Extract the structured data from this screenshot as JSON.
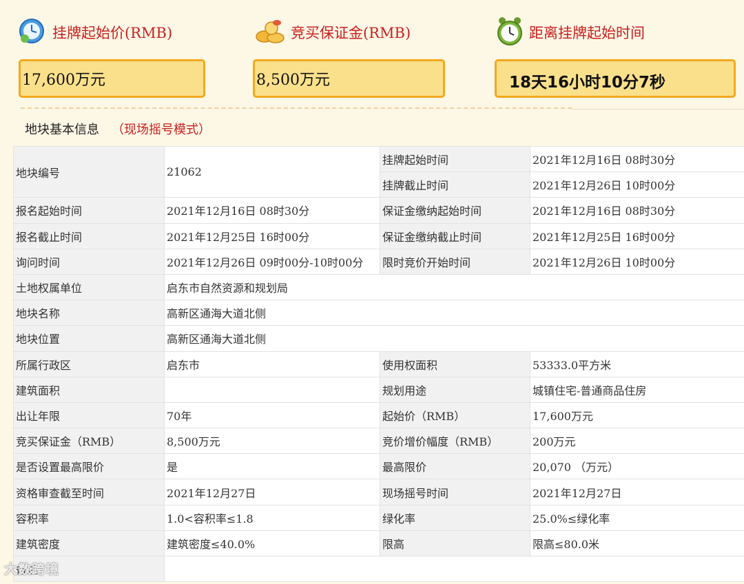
{
  "header": {
    "start_price": {
      "label": "挂牌起始价(RMB)",
      "value": "17,600万元"
    },
    "deposit": {
      "label": "竞买保证金(RMB)",
      "value": "8,500万元"
    },
    "countdown": {
      "label": "距离挂牌起始时间",
      "value": "18天16小时10分7秒"
    }
  },
  "section": {
    "title": "地块基本信息",
    "mode": "（现场摇号模式）"
  },
  "table": {
    "parcel_no": {
      "label": "地块编号",
      "value": "21062"
    },
    "listing_start": {
      "label": "挂牌起始时间",
      "value": "2021年12月16日 08时30分"
    },
    "listing_end": {
      "label": "挂牌截止时间",
      "value": "2021年12月26日 10时00分"
    },
    "rows": [
      [
        "报名起始时间",
        "2021年12月16日 08时30分",
        "保证金缴纳起始时间",
        "2021年12月16日 08时30分"
      ],
      [
        "报名截止时间",
        "2021年12月25日 16时00分",
        "保证金缴纳截止时间",
        "2021年12月25日 16时00分"
      ],
      [
        "询问时间",
        "2021年12月26日 09时00分-10时00分",
        "限时竞价开始时间",
        "2021年12月26日 10时00分"
      ]
    ],
    "wide_rows": [
      [
        "土地权属单位",
        "启东市自然资源和规划局"
      ],
      [
        "地块名称",
        "高新区通海大道北侧"
      ],
      [
        "地块位置",
        "高新区通海大道北侧"
      ]
    ],
    "rows2": [
      [
        "所属行政区",
        "启东市",
        "使用权面积",
        "53333.0平方米"
      ],
      [
        "建筑面积",
        "",
        "规划用途",
        "城镇住宅-普通商品住房"
      ],
      [
        "出让年限",
        "70年",
        "起始价（RMB）",
        "17,600万元"
      ],
      [
        "竞买保证金（RMB）",
        "8,500万元",
        "竞价增价幅度（RMB）",
        "200万元"
      ],
      [
        "是否设置最高限价",
        "是",
        "最高限价",
        "20,070 （万元）"
      ],
      [
        "资格审查截至时间",
        "2021年12月27日",
        "现场摇号时间",
        "2021年12月27日"
      ],
      [
        "容积率",
        "1.0<容积率≤1.8",
        "绿化率",
        "25.0%≤绿化率"
      ],
      [
        "建筑密度",
        "建筑密度≤40.0%",
        "限高",
        "限高≤80.0米"
      ]
    ],
    "remark": {
      "label": "备注",
      "value": ""
    }
  },
  "watermark": "大数跨境"
}
